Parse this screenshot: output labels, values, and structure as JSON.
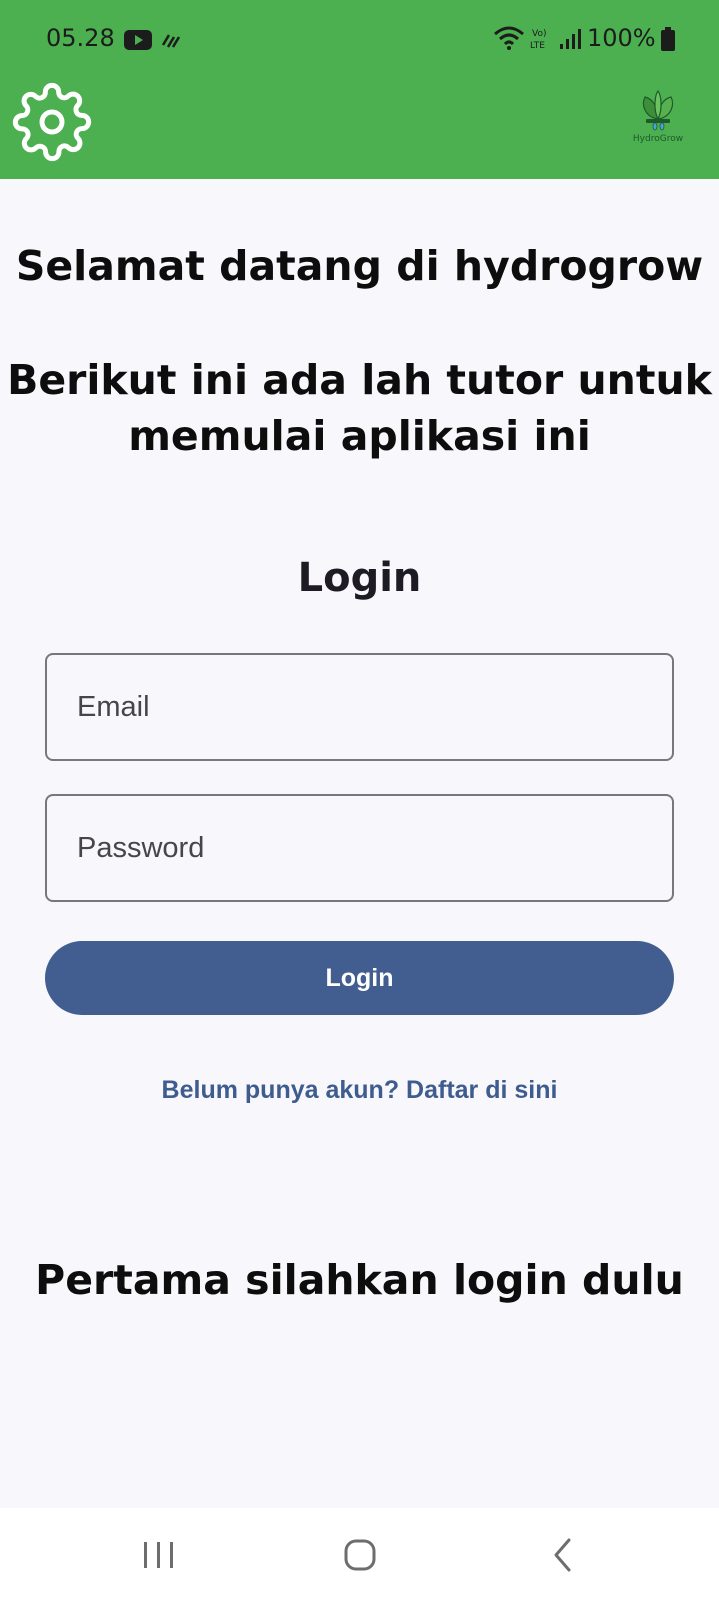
{
  "status_bar": {
    "time": "05.28",
    "battery": "100%",
    "icons": [
      "youtube-icon",
      "data-activity-icon",
      "wifi-icon",
      "volte-icon",
      "signal-icon",
      "battery-icon"
    ]
  },
  "app_bar": {
    "settings_icon": "gear-icon",
    "logo_text": "HydroGrow"
  },
  "content": {
    "welcome": "Selamat datang di hydrogrow",
    "tutor_line1": "Berikut ini ada lah tutor untuk",
    "tutor_line2": "memulai aplikasi ini",
    "login_title": "Login",
    "email_placeholder": "Email",
    "password_placeholder": "Password",
    "login_button": "Login",
    "register_link": "Belum punya akun? Daftar di sini",
    "hint": "Pertama silahkan login dulu"
  },
  "nav_bar": {
    "icons": [
      "recents-icon",
      "home-icon",
      "back-icon"
    ]
  },
  "colors": {
    "app_bar": "#4caf50",
    "background": "#f8f7fc",
    "button": "#425d90",
    "link": "#3f5c8e"
  }
}
